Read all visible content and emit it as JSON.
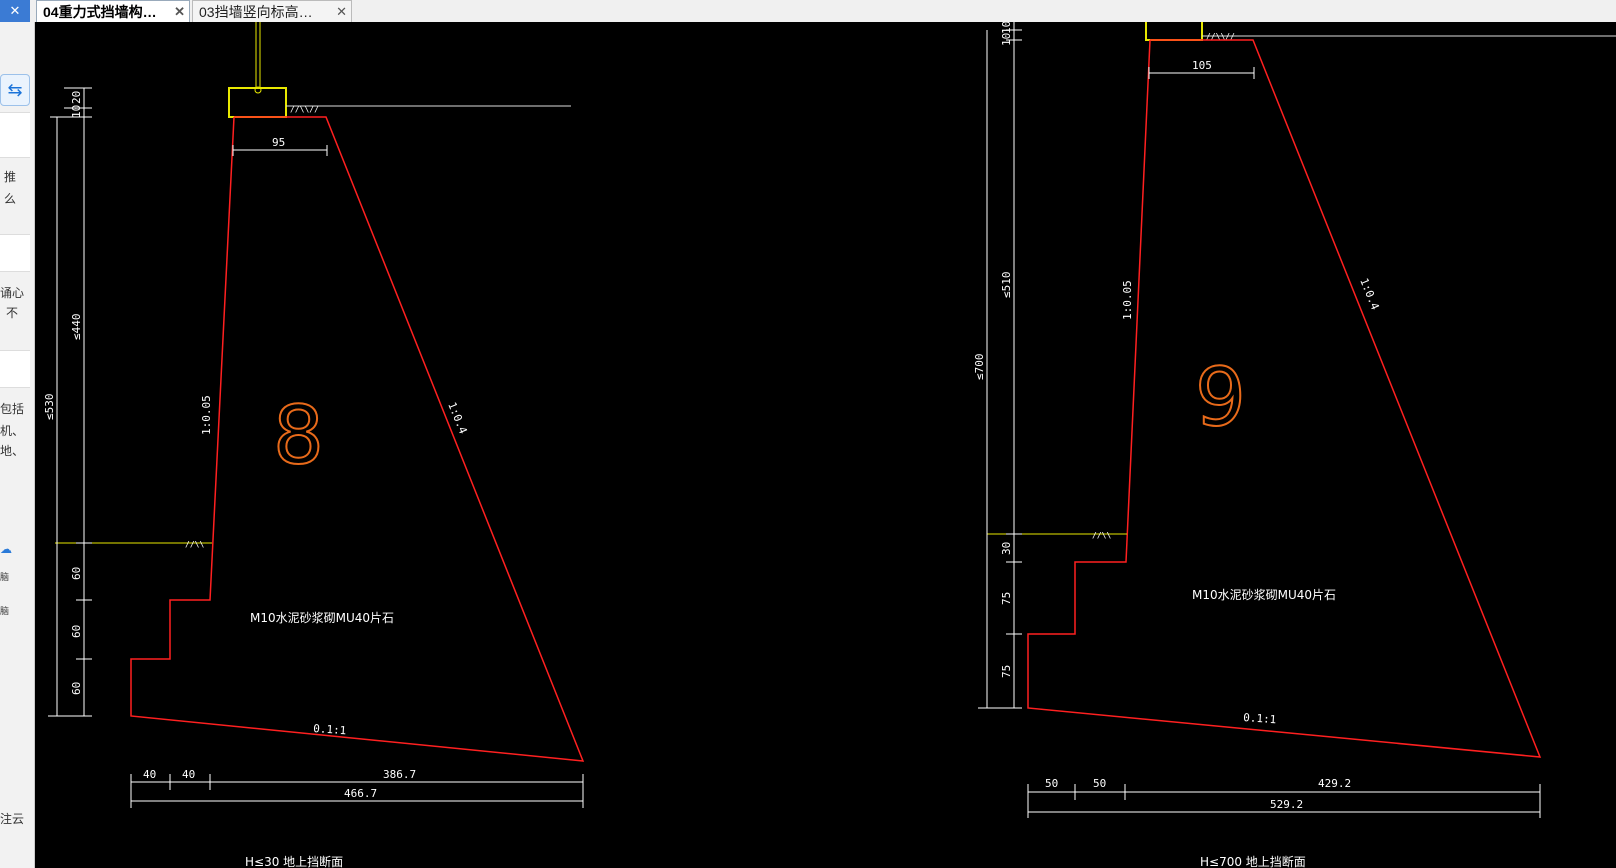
{
  "tabs": [
    {
      "label": "04重力式挡墙构…",
      "active": true
    },
    {
      "label": "03挡墙竖向标高…",
      "active": false
    }
  ],
  "close_glyph": "✕",
  "sidebar": {
    "fragments": [
      "推",
      "么",
      "诵心",
      "不",
      "包括",
      "机、",
      "地、",
      "脑",
      "脑",
      "注云"
    ]
  },
  "drawing": {
    "wall8": {
      "section_number": "8",
      "material_note": "M10水泥砂浆砌MU40片石",
      "slope_front": "1:0.05",
      "slope_back": "1:0.4",
      "slope_base": "0.1:1",
      "top_width": "95",
      "dim_top_small_1": "20",
      "dim_top_small_2": "10",
      "dim_height_upper": "≤440",
      "dim_height_total": "≤530",
      "step_dims": [
        "60",
        "60",
        "60"
      ],
      "bottom_dims": [
        "40",
        "40",
        "386.7"
      ],
      "bottom_total": "466.7",
      "caption_partial": "H≤30 地上挡断面"
    },
    "wall9": {
      "section_number": "9",
      "material_note": "M10水泥砂浆砌MU40片石",
      "slope_front": "1:0.05",
      "slope_back": "1:0.4",
      "slope_base": "0.1:1",
      "top_width": "105",
      "dim_top_small_1": "10",
      "dim_top_small_2": "10",
      "dim_height_upper": "≤510",
      "dim_height_total": "≤700",
      "step_dims": [
        "30",
        "75",
        "75"
      ],
      "bottom_dims": [
        "50",
        "50",
        "429.2"
      ],
      "bottom_total": "529.2",
      "caption_partial": "H≤700 地上挡断面"
    },
    "colors": {
      "background": "#000000",
      "wall_outline": "#ff2020",
      "dimension": "#ffffff",
      "ground_line": "#e8e800",
      "section_number": "#e86a1a"
    }
  }
}
